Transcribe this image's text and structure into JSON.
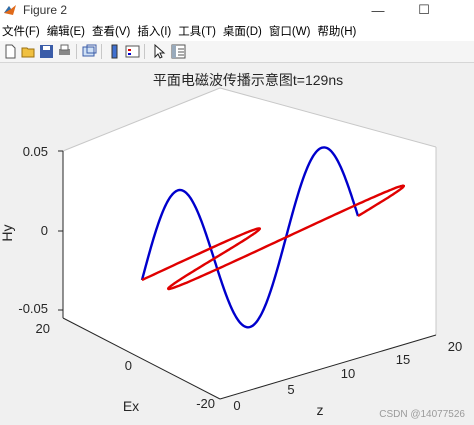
{
  "window": {
    "title": "Figure 2",
    "minimize": "—",
    "maximize": "☐"
  },
  "menu": [
    "文件(F)",
    "编辑(E)",
    "查看(V)",
    "插入(I)",
    "工具(T)",
    "桌面(D)",
    "窗口(W)",
    "帮助(H)"
  ],
  "toolbar_icons": [
    "new-file-icon",
    "open-folder-icon",
    "save-icon",
    "print-icon",
    "link-figure-icon",
    "colorbar-icon",
    "legend-icon",
    "edit-plot-arrow-icon",
    "property-editor-icon"
  ],
  "colors": {
    "wave_e": "#e00000",
    "wave_h": "#0000cc",
    "box_bg": "#ffffff",
    "figure_bg": "#f0f0f0"
  },
  "watermark": "CSDN @14077526",
  "chart_data": {
    "type": "line",
    "title": "平面电磁波传播示意图t=129ns",
    "zlabel": "Hy",
    "xlabel_left": "Ex",
    "xlabel_right": "z",
    "z_ticks": [
      "0.05",
      "0",
      "-0.05"
    ],
    "ex_ticks": [
      "20",
      "0",
      "-20"
    ],
    "z_axis_ticks": [
      "0",
      "5",
      "10",
      "15",
      "20"
    ],
    "zlim": [
      0,
      20
    ],
    "exlim": [
      -20,
      20
    ],
    "hylim": [
      -0.05,
      0.05
    ],
    "series": [
      {
        "label": "E",
        "color": "#e00000",
        "plane": "Ex",
        "amplitude": 20,
        "cycles": 1.5,
        "phase_deg": 0
      },
      {
        "label": "H",
        "color": "#0000cc",
        "plane": "Hy",
        "amplitude": 0.05,
        "cycles": 1.5,
        "phase_deg": 0
      }
    ]
  }
}
